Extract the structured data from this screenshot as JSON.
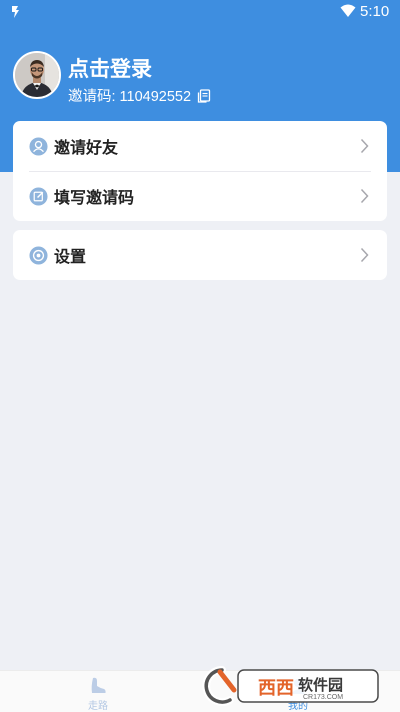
{
  "status_bar": {
    "time": "5:10",
    "left_icon": "notification-icon",
    "signal_icon": "wifi-icon"
  },
  "profile": {
    "avatar": "avatar-photo",
    "login_label": "点击登录",
    "invite_code_label": "邀请码: 110492552",
    "copy_icon": "copy-icon"
  },
  "menu": {
    "invite_friends": {
      "label": "邀请好友",
      "icon": "user-icon"
    },
    "enter_code": {
      "label": "填写邀请码",
      "icon": "edit-icon"
    },
    "settings": {
      "label": "设置",
      "icon": "target-icon"
    }
  },
  "tabs": [
    {
      "label": "走路",
      "icon": "shoe-icon",
      "active": false
    },
    {
      "label": "我的",
      "icon": "person-icon",
      "active": true
    }
  ],
  "watermark": {
    "brand": "西西软件园",
    "url": "CR173.COM"
  },
  "colors": {
    "accent": "#3e8ee0",
    "background": "#eef0f5",
    "card": "#ffffff",
    "icon_badge": "#8fb4dc"
  }
}
